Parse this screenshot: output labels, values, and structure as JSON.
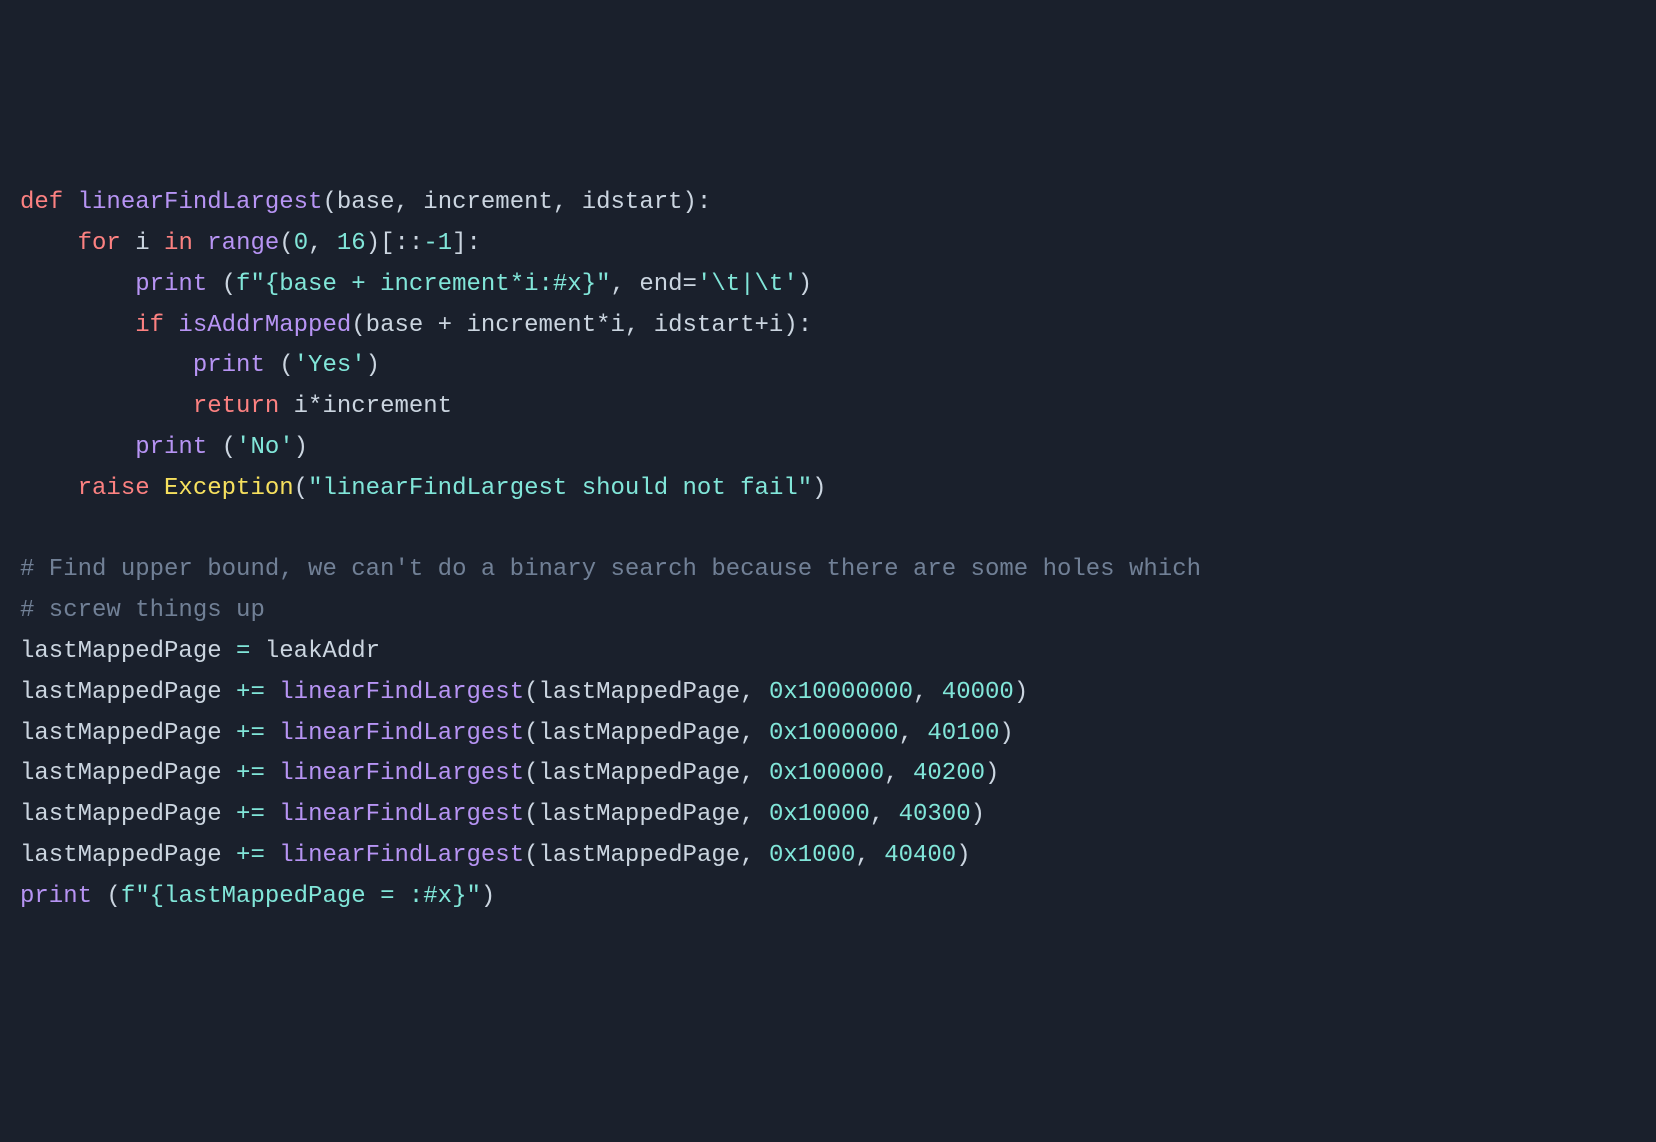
{
  "code": {
    "line1": {
      "def": "def",
      "funcname": "linearFindLargest",
      "params": "(base, increment, idstart):"
    },
    "line2": {
      "indent": "    ",
      "for": "for",
      "var": " i ",
      "in": "in",
      "range": " range",
      "args": "(",
      "zero": "0",
      "comma": ", ",
      "sixteen": "16",
      "slice": ")[::",
      "minusone": "-1",
      "end": "]:"
    },
    "line3": {
      "indent": "        ",
      "print": "print",
      "open": " (",
      "fstring": "f\"{base + increment*i:#x}\"",
      "comma": ", end=",
      "endstr": "'\\t|\\t'",
      "close": ")"
    },
    "line4": {
      "indent": "        ",
      "if": "if",
      "func": " isAddrMapped",
      "args": "(base + increment*i, idstart+i):"
    },
    "line5": {
      "indent": "            ",
      "print": "print",
      "open": " (",
      "str": "'Yes'",
      "close": ")"
    },
    "line6": {
      "indent": "            ",
      "return": "return",
      "expr": " i*increment"
    },
    "line7": {
      "indent": "        ",
      "print": "print",
      "open": " (",
      "str": "'No'",
      "close": ")"
    },
    "line8": {
      "indent": "    ",
      "raise": "raise",
      "exc": " Exception",
      "open": "(",
      "str": "\"linearFindLargest should not fail\"",
      "close": ")"
    },
    "line9": "",
    "line10": {
      "comment": "# Find upper bound, we can't do a binary search because there are some holes which"
    },
    "line11": {
      "comment": "# screw things up"
    },
    "line12": {
      "var1": "lastMappedPage ",
      "op": "=",
      "var2": " leakAddr"
    },
    "line13": {
      "var": "lastMappedPage ",
      "op": "+=",
      "func": " linearFindLargest",
      "open": "(lastMappedPage, ",
      "hex": "0x10000000",
      "comma": ", ",
      "num": "40000",
      "close": ")"
    },
    "line14": {
      "var": "lastMappedPage ",
      "op": "+=",
      "func": " linearFindLargest",
      "open": "(lastMappedPage, ",
      "hex": "0x1000000",
      "comma": ", ",
      "num": "40100",
      "close": ")"
    },
    "line15": {
      "var": "lastMappedPage ",
      "op": "+=",
      "func": " linearFindLargest",
      "open": "(lastMappedPage, ",
      "hex": "0x100000",
      "comma": ", ",
      "num": "40200",
      "close": ")"
    },
    "line16": {
      "var": "lastMappedPage ",
      "op": "+=",
      "func": " linearFindLargest",
      "open": "(lastMappedPage, ",
      "hex": "0x10000",
      "comma": ", ",
      "num": "40300",
      "close": ")"
    },
    "line17": {
      "var": "lastMappedPage ",
      "op": "+=",
      "func": " linearFindLargest",
      "open": "(lastMappedPage, ",
      "hex": "0x1000",
      "comma": ", ",
      "num": "40400",
      "close": ")"
    },
    "line18": {
      "print": "print",
      "open": " (",
      "fstring": "f\"{lastMappedPage = :#x}\"",
      "close": ")"
    }
  }
}
